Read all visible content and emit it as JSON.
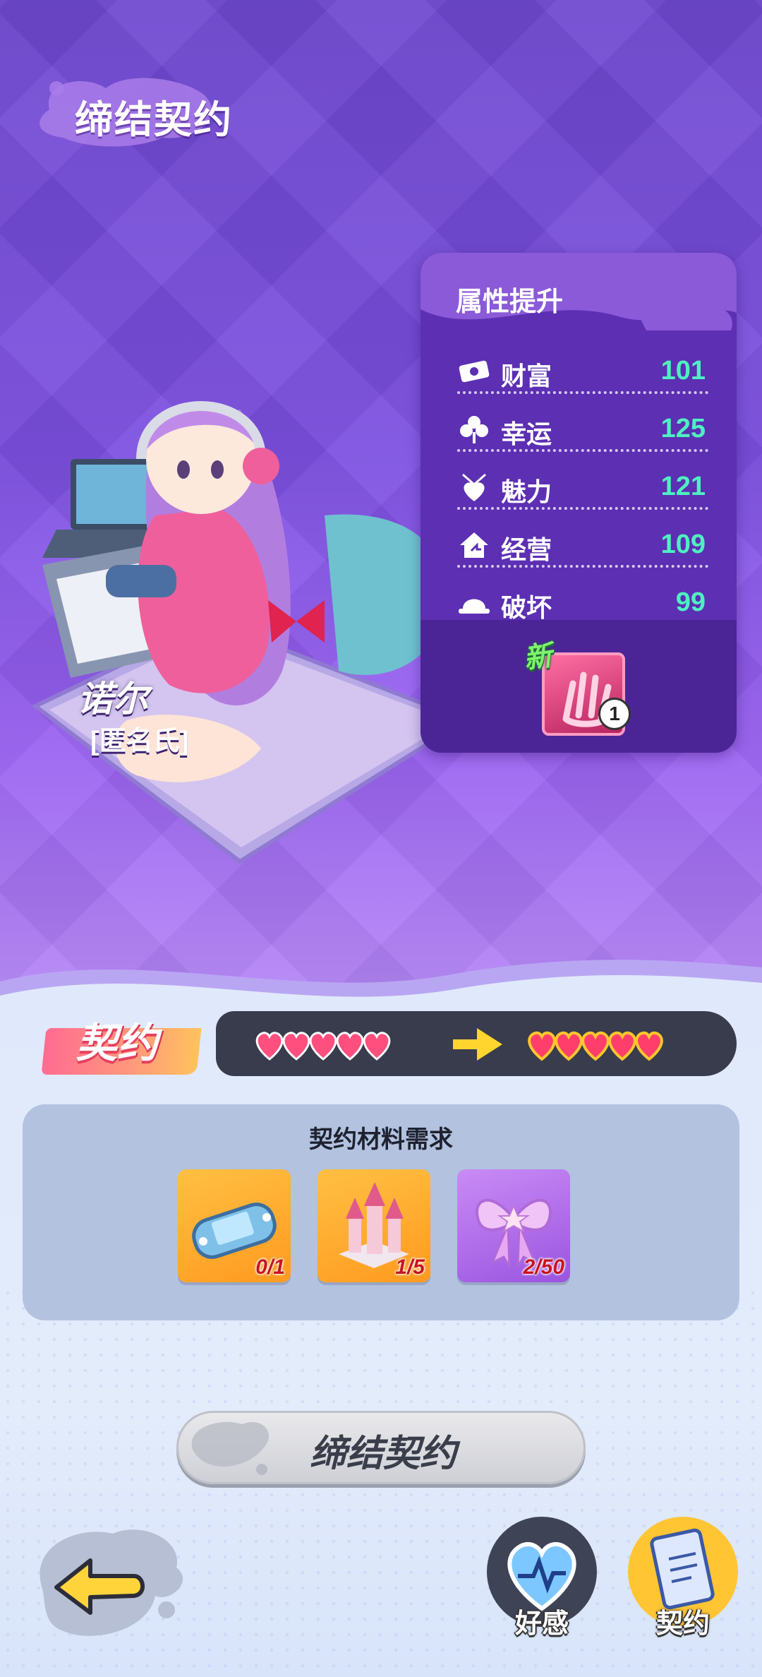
{
  "page": {
    "title": "缔结契约"
  },
  "character": {
    "name": "诺尔",
    "subtitle": "[匿名氏]"
  },
  "attributes": {
    "title": "属性提升",
    "items": [
      {
        "label": "财富",
        "value": "101",
        "icon": "money-icon"
      },
      {
        "label": "幸运",
        "value": "125",
        "icon": "clover-icon"
      },
      {
        "label": "魅力",
        "value": "121",
        "icon": "heart-necklace-icon"
      },
      {
        "label": "经营",
        "value": "109",
        "icon": "house-icon"
      },
      {
        "label": "破坏",
        "value": "99",
        "icon": "helmet-icon"
      }
    ],
    "new_tag": "新",
    "skill_level": "1"
  },
  "contract": {
    "label": "契约",
    "current_hearts": 5,
    "next_hearts": 5
  },
  "materials": {
    "title": "契约材料需求",
    "items": [
      {
        "name": "game-console",
        "count": "0/1",
        "style": "orange"
      },
      {
        "name": "castle",
        "count": "1/5",
        "style": "orange"
      },
      {
        "name": "bow",
        "count": "2/50",
        "style": "purple"
      }
    ]
  },
  "actions": {
    "sign_label": "缔结契约"
  },
  "nav": {
    "affection_label": "好感",
    "contract_label": "契约"
  },
  "colors": {
    "accent_value": "#4ef0c0",
    "panel": "#5c2fb3",
    "count_red": "#c8151f"
  }
}
